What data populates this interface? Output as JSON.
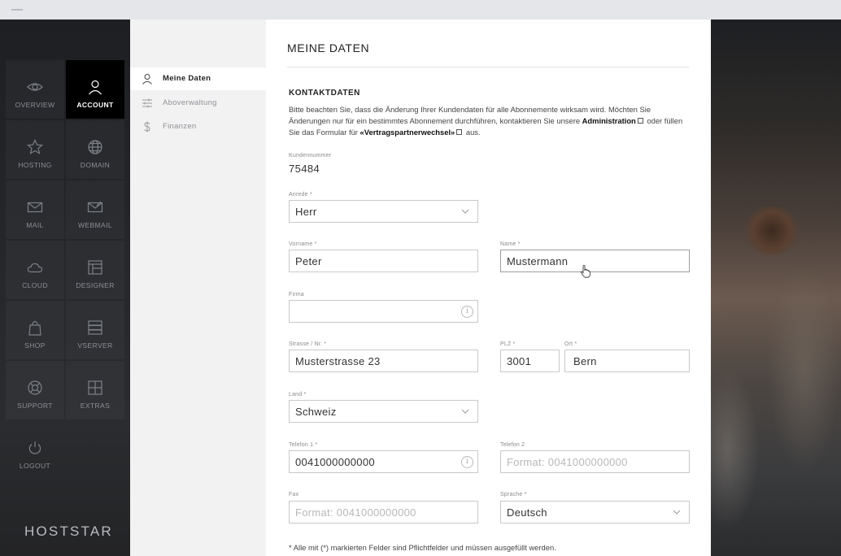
{
  "nav": {
    "items": [
      {
        "label": "OVERVIEW",
        "icon": "eye-icon"
      },
      {
        "label": "ACCOUNT",
        "icon": "user-icon"
      },
      {
        "label": "HOSTING",
        "icon": "star-icon"
      },
      {
        "label": "DOMAIN",
        "icon": "globe-icon"
      },
      {
        "label": "MAIL",
        "icon": "mail-icon"
      },
      {
        "label": "WEBMAIL",
        "icon": "webmail-icon"
      },
      {
        "label": "CLOUD",
        "icon": "cloud-icon"
      },
      {
        "label": "DESIGNER",
        "icon": "layout-icon"
      },
      {
        "label": "SHOP",
        "icon": "bag-icon"
      },
      {
        "label": "VSERVER",
        "icon": "server-icon"
      },
      {
        "label": "SUPPORT",
        "icon": "lifebuoy-icon"
      },
      {
        "label": "EXTRAS",
        "icon": "grid-icon"
      },
      {
        "label": "LOGOUT",
        "icon": "power-icon"
      }
    ],
    "active": "ACCOUNT",
    "logo": "HOSTSTAR"
  },
  "subnav": {
    "items": [
      {
        "label": "Meine Daten",
        "icon": "user-icon"
      },
      {
        "label": "Aboverwaltung",
        "icon": "sliders-icon"
      },
      {
        "label": "Finanzen",
        "icon": "dollar-icon"
      }
    ],
    "active": "Meine Daten"
  },
  "main": {
    "title": "MEINE DATEN",
    "section_title": "KONTAKTDATEN",
    "notice": {
      "part1": "Bitte beachten Sie, dass die Änderung Ihrer Kundendaten für alle Abonnemente wirksam wird. Möchten Sie Änderungen nur für ein bestimmtes Abonnement durchführen, kontaktieren Sie unsere ",
      "link1": "Administration",
      "part2": " oder füllen Sie das Formular für ",
      "link2": "«Vertragspartnerwechsel»",
      "part3": " aus."
    },
    "customer_number": {
      "label": "Kundennummer",
      "value": "75484"
    },
    "fields": {
      "anrede": {
        "label": "Anrede *",
        "value": "Herr"
      },
      "vorname": {
        "label": "Vorname *",
        "value": "Peter"
      },
      "name": {
        "label": "Name *",
        "value": "Mustermann"
      },
      "firma": {
        "label": "Firma",
        "value": ""
      },
      "strasse": {
        "label": "Strasse / Nr. *",
        "value": "Musterstrasse 23"
      },
      "plz": {
        "label": "PLZ *",
        "value": "3001"
      },
      "ort": {
        "label": "Ort *",
        "value": "Bern"
      },
      "land": {
        "label": "Land *",
        "value": "Schweiz"
      },
      "telefon1": {
        "label": "Telefon 1 *",
        "value": "0041000000000"
      },
      "telefon2": {
        "label": "Telefon 2",
        "placeholder": "Format: 0041000000000"
      },
      "fax": {
        "label": "Fax",
        "placeholder": "Format: 0041000000000"
      },
      "sprache": {
        "label": "Sprache *",
        "value": "Deutsch"
      }
    },
    "footnote": "* Alle mit (*) markierten Felder sind Pflichtfelder und müssen ausgefüllt werden."
  }
}
